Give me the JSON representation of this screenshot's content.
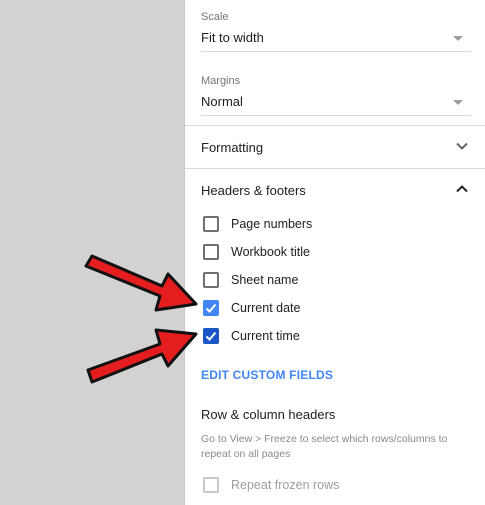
{
  "scale": {
    "label": "Scale",
    "value": "Fit to width"
  },
  "margins": {
    "label": "Margins",
    "value": "Normal"
  },
  "formatting": {
    "title": "Formatting",
    "expanded": false
  },
  "headers_footers": {
    "title": "Headers & footers",
    "expanded": true,
    "options": [
      {
        "label": "Page numbers",
        "checked": false
      },
      {
        "label": "Workbook title",
        "checked": false
      },
      {
        "label": "Sheet name",
        "checked": false
      },
      {
        "label": "Current date",
        "checked": true
      },
      {
        "label": "Current time",
        "checked": true
      }
    ],
    "edit_link": "EDIT CUSTOM FIELDS"
  },
  "row_column_headers": {
    "title": "Row & column headers",
    "help": "Go to View > Freeze to select which rows/columns to repeat on all pages",
    "repeat_label": "Repeat frozen rows",
    "repeat_checked": false,
    "repeat_disabled": true
  },
  "colors": {
    "accent": "#4285f4",
    "annotation_arrow": "#e41e1e"
  }
}
